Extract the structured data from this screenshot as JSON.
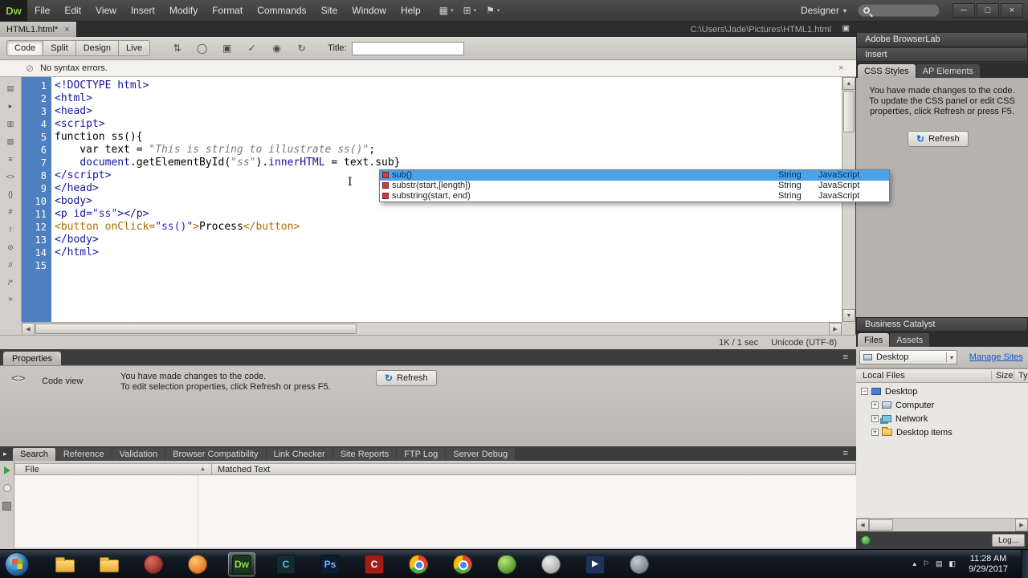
{
  "ui": {
    "up": "▲",
    "down": "▼",
    "left": "◀",
    "right": "▶",
    "ibeam": "I"
  },
  "menubar": {
    "logo": "Dw",
    "items": [
      "File",
      "Edit",
      "View",
      "Insert",
      "Modify",
      "Format",
      "Commands",
      "Site",
      "Window",
      "Help"
    ],
    "app_icons": [
      {
        "name": "layout-switcher-icon",
        "glyph": "▦"
      },
      {
        "name": "extend-dreamweaver-icon",
        "glyph": "⊞"
      },
      {
        "name": "site-setup-icon",
        "glyph": "⚑"
      }
    ],
    "workspace_label": "Designer",
    "caret": "▾",
    "window_controls": [
      {
        "name": "minimize-button",
        "glyph": "─"
      },
      {
        "name": "maximize-button",
        "glyph": "□"
      },
      {
        "name": "close-button",
        "glyph": "×"
      }
    ]
  },
  "tabbar": {
    "tab_label": "HTML1.html*",
    "tab_close": "×",
    "path": "C:\\Users\\Jade\\Pictures\\HTML1.html",
    "panel_toggle": "▣"
  },
  "doc_toolbar": {
    "views": [
      "Code",
      "Split",
      "Design",
      "Live"
    ],
    "active_view": "Code",
    "icons": [
      {
        "name": "file-management-icon",
        "glyph": "⇅"
      },
      {
        "name": "preview-in-browser-icon",
        "glyph": "◯"
      },
      {
        "name": "multiscreen-preview-icon",
        "glyph": "▣"
      },
      {
        "name": "w3c-validation-icon",
        "glyph": "✓"
      },
      {
        "name": "visual-aids-icon",
        "glyph": "◉"
      },
      {
        "name": "refresh-design-view-icon",
        "glyph": "↻"
      }
    ],
    "title_label": "Title:",
    "title_value": ""
  },
  "info_bar": {
    "icon": "⊘",
    "message": "No syntax errors.",
    "close": "×"
  },
  "editor": {
    "tool_icons": [
      {
        "name": "open-documents-icon",
        "glyph": "▤"
      },
      {
        "name": "show-code-navigator-icon",
        "glyph": "▸"
      },
      {
        "name": "collapse-full-tag-icon",
        "glyph": "▥"
      },
      {
        "name": "collapse-selection-icon",
        "glyph": "▧"
      },
      {
        "name": "expand-all-icon",
        "glyph": "≡"
      },
      {
        "name": "select-parent-tag-icon",
        "glyph": "<>"
      },
      {
        "name": "balance-braces-icon",
        "glyph": "{}"
      },
      {
        "name": "line-numbers-icon",
        "glyph": "#"
      },
      {
        "name": "highlight-invalid-code-icon",
        "glyph": "!"
      },
      {
        "name": "syntax-error-alerts-icon",
        "glyph": "⊘"
      },
      {
        "name": "apply-comment-icon",
        "glyph": "//"
      },
      {
        "name": "remove-comment-icon",
        "glyph": "/*"
      }
    ],
    "more_chevron": "»",
    "lines": [
      {
        "n": 1,
        "seg": [
          [
            "t",
            "<!DOCTYPE html>"
          ]
        ]
      },
      {
        "n": 2,
        "seg": [
          [
            "t",
            "<html>"
          ]
        ]
      },
      {
        "n": 3,
        "seg": [
          [
            "t",
            "<head>"
          ]
        ]
      },
      {
        "n": 4,
        "seg": [
          [
            "t",
            "<script>"
          ]
        ]
      },
      {
        "n": 5,
        "seg": [
          [
            "p",
            "function ss(){"
          ]
        ]
      },
      {
        "n": 6,
        "seg": [
          [
            "p",
            "    var text = "
          ],
          [
            "s",
            "\"This is string to illustrate ss()\""
          ],
          [
            "p",
            ";"
          ]
        ]
      },
      {
        "n": 7,
        "seg": [
          [
            "p",
            "    "
          ],
          [
            "o",
            "document"
          ],
          [
            "p",
            ".getElementById("
          ],
          [
            "s",
            "\"ss\""
          ],
          [
            "p",
            ")."
          ],
          [
            "o",
            "innerHTML"
          ],
          [
            "p",
            " = text.sub}"
          ]
        ]
      },
      {
        "n": 8,
        "seg": [
          [
            "t",
            "</script>"
          ]
        ]
      },
      {
        "n": 9,
        "seg": [
          [
            "t",
            "</head>"
          ]
        ]
      },
      {
        "n": 10,
        "seg": [
          [
            "t",
            "<body>"
          ]
        ]
      },
      {
        "n": 11,
        "seg": [
          [
            "t",
            "<p id="
          ],
          [
            "v",
            "\"ss\""
          ],
          [
            "t",
            "></p>"
          ]
        ]
      },
      {
        "n": 12,
        "seg": [
          [
            "f",
            "<button onClick="
          ],
          [
            "v",
            "\"ss()\""
          ],
          [
            "f",
            ">"
          ],
          [
            "p",
            "Process"
          ],
          [
            "f",
            "</button>"
          ]
        ]
      },
      {
        "n": 13,
        "seg": [
          [
            "t",
            "</body>"
          ]
        ]
      },
      {
        "n": 14,
        "seg": [
          [
            "t",
            "</html>"
          ]
        ]
      },
      {
        "n": 15,
        "seg": []
      }
    ],
    "status": {
      "size_time": "1K / 1 sec",
      "encoding": "Unicode (UTF-8)"
    }
  },
  "autocomplete": {
    "items": [
      {
        "name": "sub()",
        "type": "String",
        "lang": "JavaScript",
        "selected": true
      },
      {
        "name": "substr(start,[length])",
        "type": "String",
        "lang": "JavaScript",
        "selected": false
      },
      {
        "name": "substring(start, end)",
        "type": "String",
        "lang": "JavaScript",
        "selected": false
      }
    ]
  },
  "properties_panel": {
    "tab": "Properties",
    "menu_icon": "≡",
    "view_icon": "<>",
    "view_label": "Code view",
    "message_line1": "You have made changes to the code.",
    "message_line2": "To edit selection properties, click Refresh or press F5.",
    "refresh_label": "Refresh",
    "refresh_icon": "↻"
  },
  "results_panel": {
    "tabs": [
      "Search",
      "Reference",
      "Validation",
      "Browser Compatibility",
      "Link Checker",
      "Site Reports",
      "FTP Log",
      "Server Debug"
    ],
    "active_tab": "Search",
    "expander": "▸",
    "menu_icon": "≡",
    "col_file": "File",
    "sort_arrow": "▲",
    "col_matched": "Matched Text"
  },
  "right_panels": {
    "browserlab_title": "Adobe BrowserLab",
    "insert_title": "Insert",
    "css_tab": "CSS Styles",
    "ap_tab": "AP Elements",
    "css_message_line1": "You have made changes to the code.",
    "css_message_line2": "To update the CSS panel or edit CSS",
    "css_message_line3": "properties, click Refresh or press F5.",
    "refresh_label": "Refresh",
    "refresh_icon": "↻",
    "business_catalyst_title": "Business Catalyst",
    "files_tab": "Files",
    "assets_tab": "Assets",
    "site_dropdown_value": "Desktop",
    "dropdown_caret": "▾",
    "manage_sites_label": "Manage Sites",
    "col_local_files": "Local Files",
    "col_size": "Size",
    "col_type": "Typ",
    "tree": [
      {
        "label": "Desktop",
        "level": 0,
        "expander": "−",
        "icon": "desktop"
      },
      {
        "label": "Computer",
        "level": 1,
        "expander": "+",
        "icon": "computer"
      },
      {
        "label": "Network",
        "level": 1,
        "expander": "+",
        "icon": "network"
      },
      {
        "label": "Desktop items",
        "level": 1,
        "expander": "+",
        "icon": "folder"
      }
    ],
    "log_button_label": "Log..."
  },
  "taskbar": {
    "apps": [
      {
        "name": "windows-explorer",
        "kind": "folder",
        "label": ""
      },
      {
        "name": "libraries-folder",
        "kind": "folder",
        "label": ""
      },
      {
        "name": "aimp-player",
        "kind": "sphere-red",
        "label": ""
      },
      {
        "name": "firefox",
        "kind": "sphere-orange",
        "label": ""
      },
      {
        "name": "dreamweaver",
        "kind": "square-dw",
        "label": "Dw",
        "active": true
      },
      {
        "name": "captivate",
        "kind": "square-dark",
        "label": "C"
      },
      {
        "name": "photoshop",
        "kind": "square-ps",
        "label": "Ps"
      },
      {
        "name": "red-c-app",
        "kind": "square-red",
        "label": "C"
      },
      {
        "name": "chrome-1",
        "kind": "chrome",
        "label": ""
      },
      {
        "name": "chrome-2",
        "kind": "chrome",
        "label": ""
      },
      {
        "name": "green-sphere-app",
        "kind": "sphere-green",
        "label": ""
      },
      {
        "name": "gray-sphere-app",
        "kind": "sphere-gray",
        "label": ""
      },
      {
        "name": "media-player-classic",
        "kind": "square-mpc",
        "label": "▶"
      },
      {
        "name": "settings-app",
        "kind": "sphere-steel",
        "label": ""
      }
    ],
    "tray": [
      {
        "name": "hidden-icons-arrow",
        "glyph": "▴"
      },
      {
        "name": "action-center-icon",
        "glyph": "⚐"
      },
      {
        "name": "network-icon",
        "glyph": "▤"
      },
      {
        "name": "volume-icon",
        "glyph": "◧"
      }
    ],
    "clock_time": "11:28 AM",
    "clock_date": "9/29/2017"
  }
}
